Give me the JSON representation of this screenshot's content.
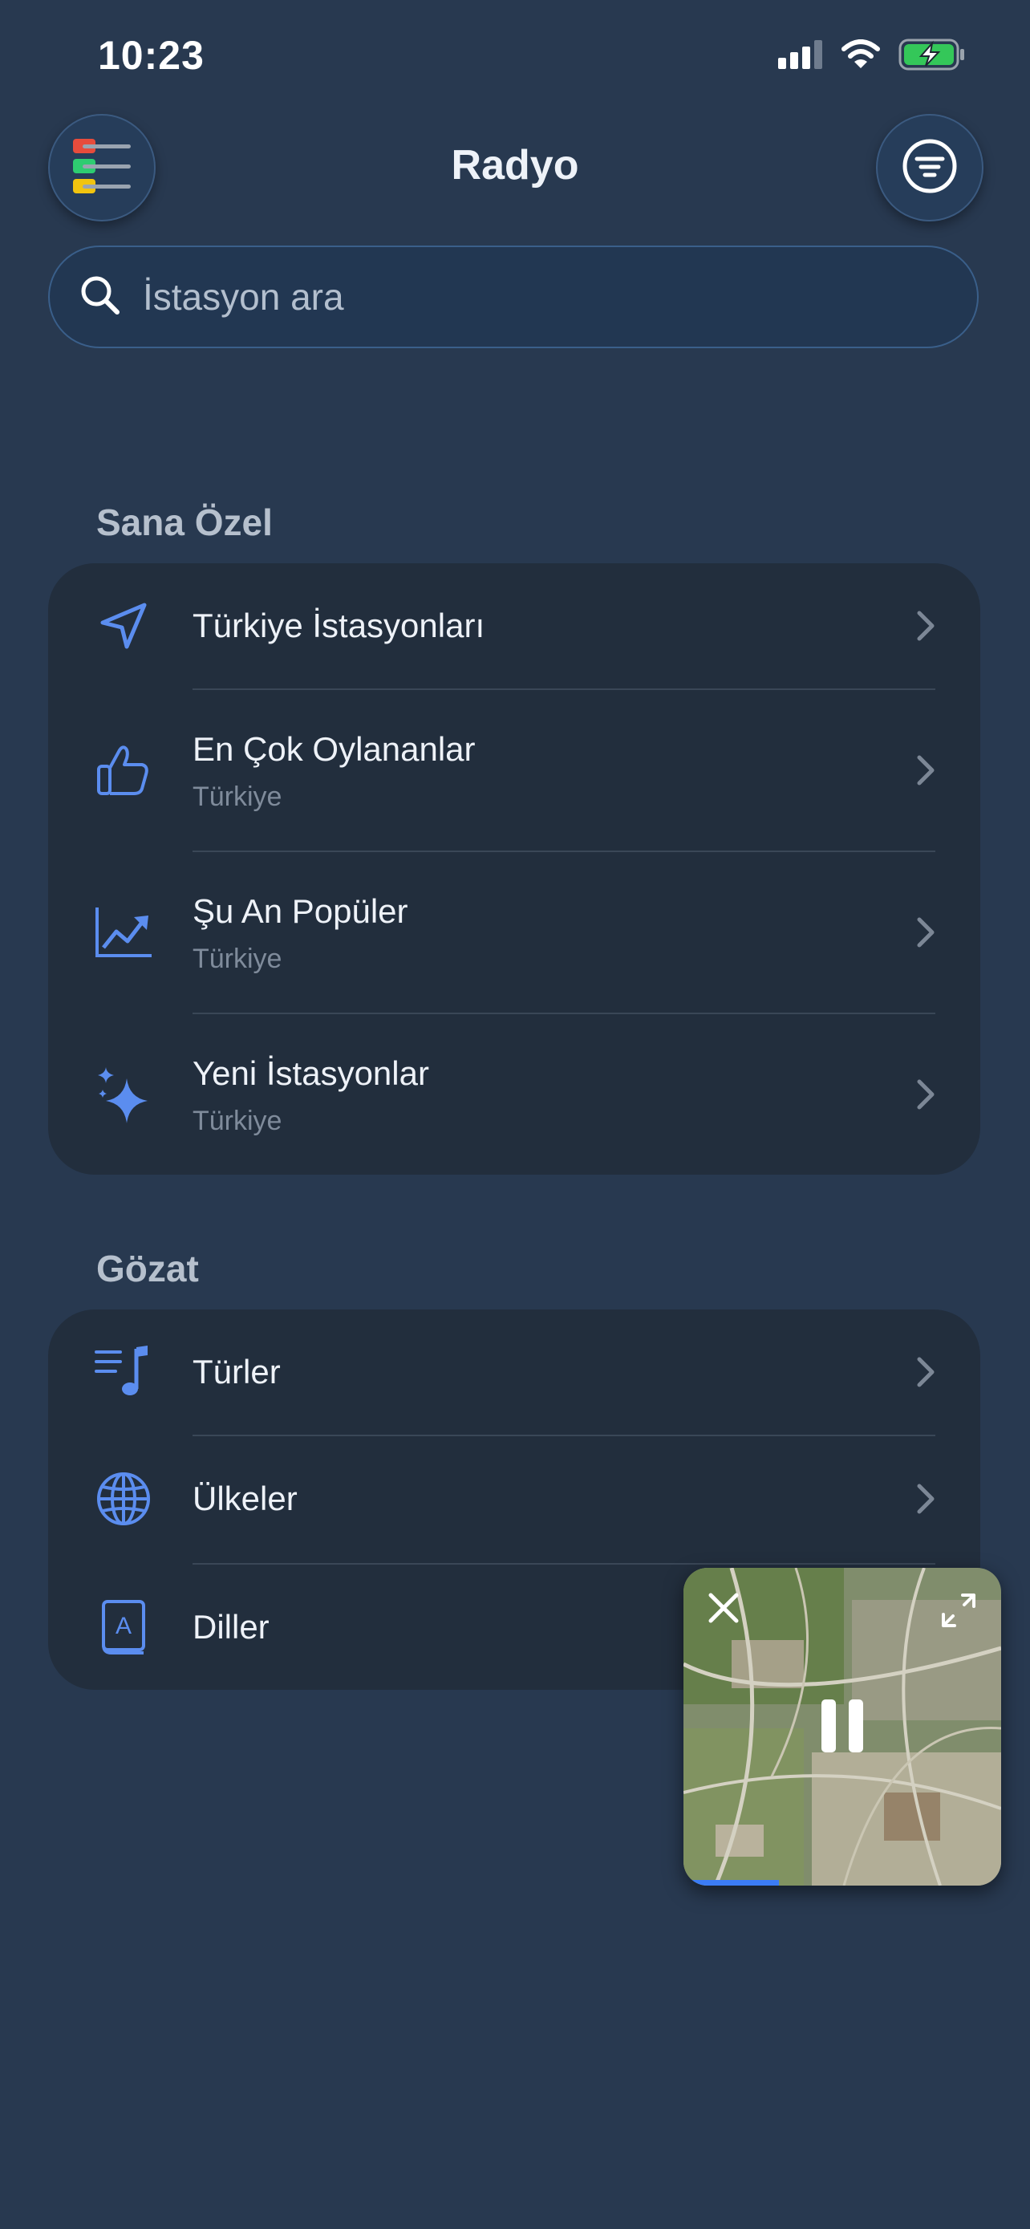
{
  "status_bar": {
    "time": "10:23",
    "icons": [
      "cellular-signal-icon",
      "wifi-icon",
      "battery-charging-icon"
    ]
  },
  "header": {
    "title": "Radyo",
    "left_button_icon": "radio-list-icon",
    "right_button_icon": "filter-icon"
  },
  "search": {
    "placeholder": "İstasyon ara",
    "icon": "search-icon"
  },
  "sections": {
    "personal": {
      "title": "Sana Özel",
      "items": [
        {
          "title": "Türkiye İstasyonları",
          "subtitle": "",
          "icon": "location-arrow-icon"
        },
        {
          "title": "En Çok Oylananlar",
          "subtitle": "Türkiye",
          "icon": "thumbs-up-icon"
        },
        {
          "title": "Şu An Popüler",
          "subtitle": "Türkiye",
          "icon": "trending-chart-icon"
        },
        {
          "title": "Yeni İstasyonlar",
          "subtitle": "Türkiye",
          "icon": "sparkles-icon"
        }
      ]
    },
    "browse": {
      "title": "Gözat",
      "items": [
        {
          "title": "Türler",
          "icon": "music-list-icon"
        },
        {
          "title": "Ülkeler",
          "icon": "globe-icon"
        },
        {
          "title": "Diller",
          "icon": "dictionary-icon"
        }
      ]
    }
  },
  "mini_player": {
    "state": "playing",
    "progress": 0.3,
    "icons": [
      "close-icon",
      "expand-icon",
      "pause-icon"
    ]
  },
  "colors": {
    "background": "#283950",
    "card": "#222e3d",
    "accent": "#5b8def",
    "search_border": "#3a5f8a"
  }
}
